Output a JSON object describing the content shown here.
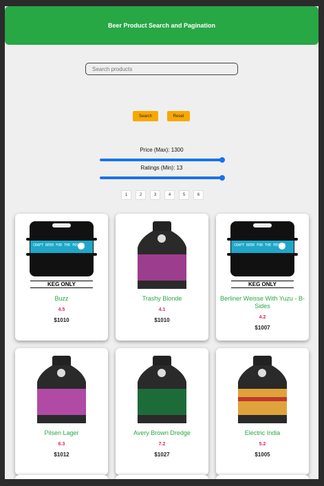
{
  "header": {
    "title": "Beer Product Search and Pagination"
  },
  "search": {
    "placeholder": "Search products",
    "search_label": "Search",
    "reset_label": "Reset"
  },
  "filters": {
    "price_label": "Price (Max): 1300",
    "price_fraction": 1.0,
    "rating_label": "Ratings (Min): 13",
    "rating_fraction": 1.0
  },
  "pagination": [
    "1",
    "2",
    "3",
    "4",
    "5",
    "6"
  ],
  "products": [
    {
      "name": "Buzz",
      "rating": "4.5",
      "price": "$1010",
      "image": "keg-only-icon",
      "label_color": "#1fa7c9",
      "keg_text": "KEG ONLY",
      "label_text": "CRAFT BEER FOR THE PEOPLE"
    },
    {
      "name": "Trashy Blonde",
      "rating": "4.1",
      "price": "$1010",
      "image": "bottle-icon",
      "label_color": "#9c3d8e"
    },
    {
      "name": "Berliner Weisse With Yuzu - B-Sides",
      "rating": "4.2",
      "price": "$1007",
      "image": "keg-only-icon",
      "label_color": "#1fa7c9",
      "keg_text": "KEG ONLY",
      "label_text": "CRAFT BEER FOR THE PEOPLE"
    },
    {
      "name": "Pilsen Lager",
      "rating": "6.3",
      "price": "$1012",
      "image": "bottle-icon",
      "label_color": "#b04aa4"
    },
    {
      "name": "Avery Brown Dredge",
      "rating": "7.2",
      "price": "$1027",
      "image": "bottle-icon",
      "label_color": "#1e6b3a"
    },
    {
      "name": "Electric India",
      "rating": "5.2",
      "price": "$1005",
      "image": "bottle-icon",
      "label_color": "#e0a23a"
    }
  ]
}
